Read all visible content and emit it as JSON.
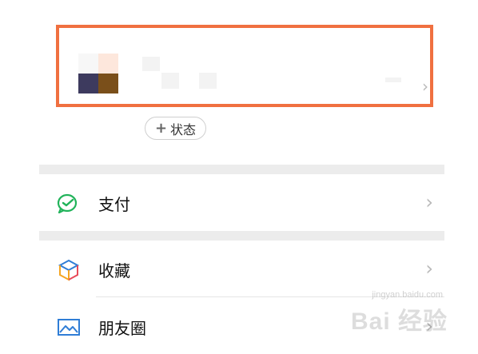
{
  "profile": {
    "status_button_plus": "+",
    "status_button_label": "状态"
  },
  "menu": {
    "items": [
      {
        "label": "支付",
        "icon": "wechat-pay-icon"
      },
      {
        "label": "收藏",
        "icon": "favorites-cube-icon"
      },
      {
        "label": "朋友圈",
        "icon": "moments-picture-icon"
      }
    ]
  },
  "watermark": {
    "brand": "Bai 经验",
    "url": "jingyan.baidu.com"
  },
  "colors": {
    "highlight_border": "#f07040",
    "separator": "#ececec",
    "pay_green": "#21b35a",
    "favorites_orange": "#f5a623",
    "moments_blue": "#2f7dd6"
  }
}
